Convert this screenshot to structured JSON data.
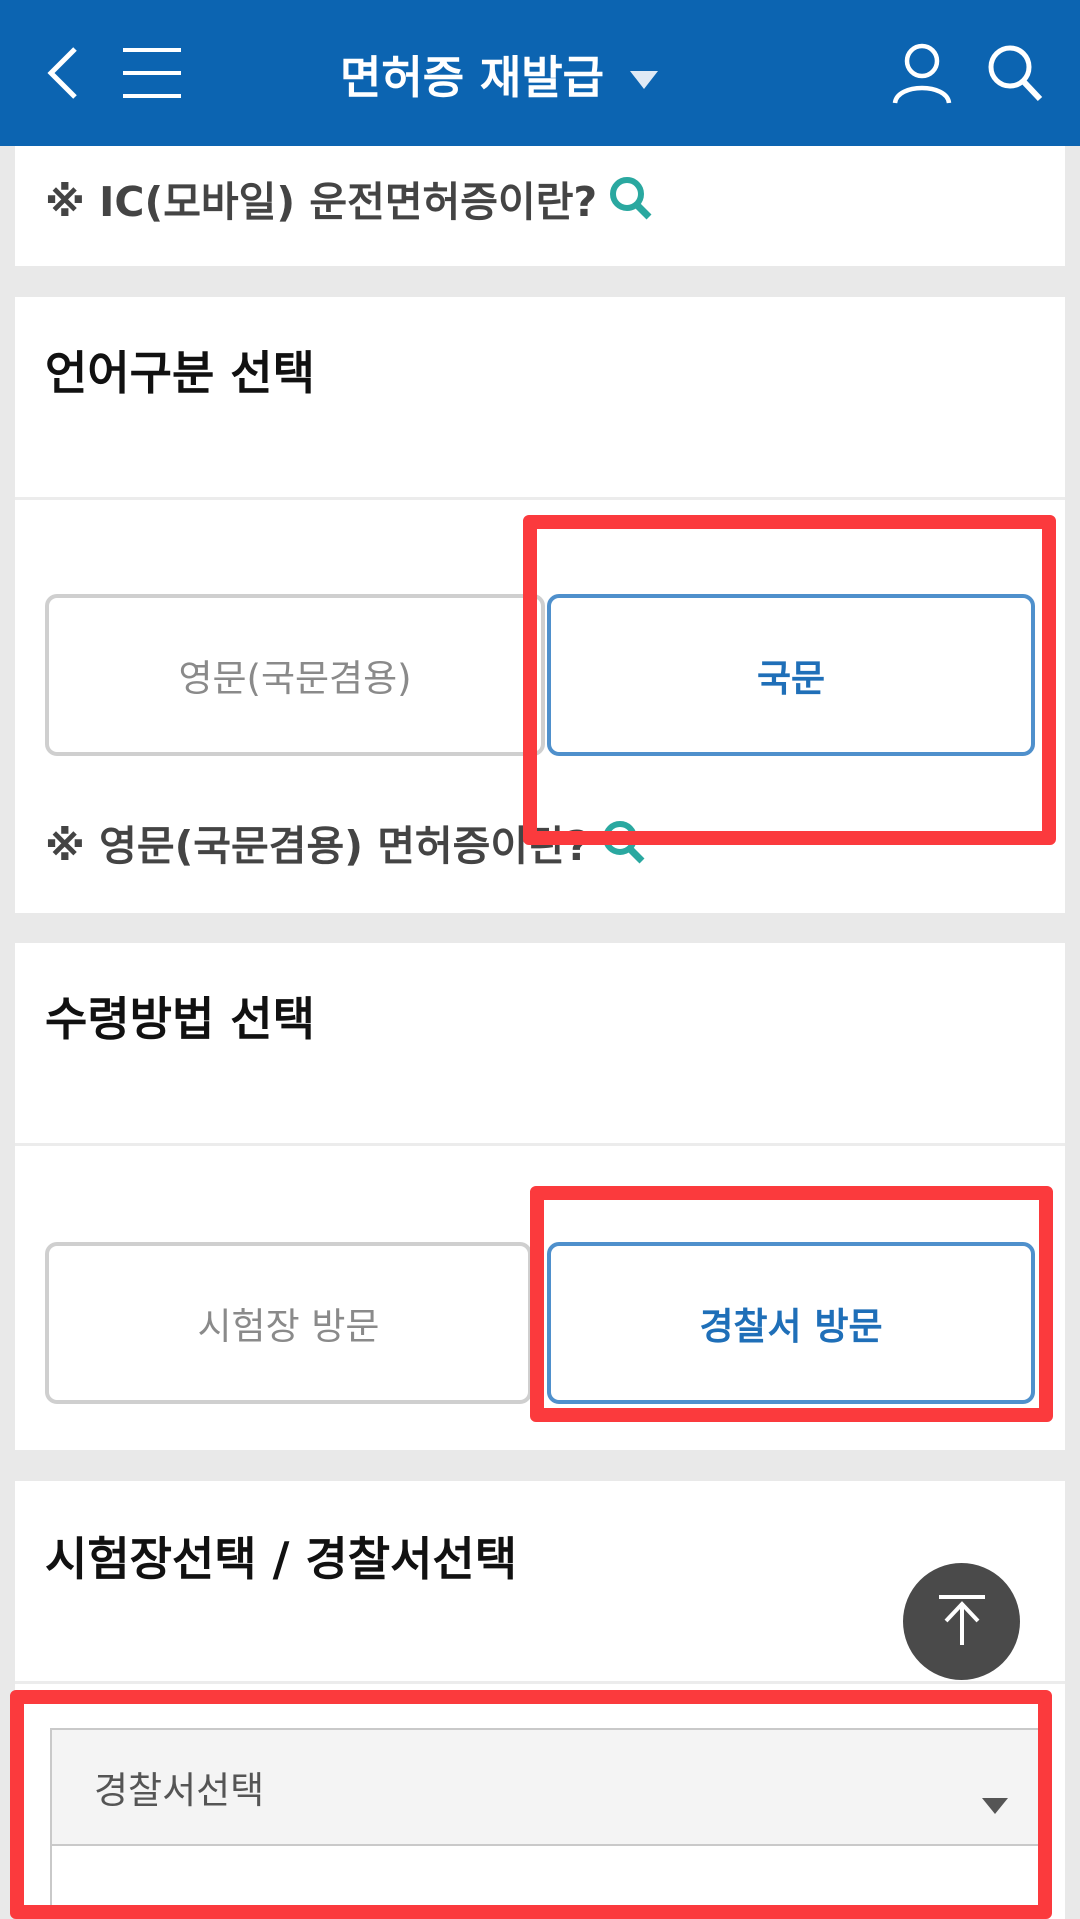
{
  "header": {
    "title": "면허증 재발급",
    "icons": [
      "back-arrow-icon",
      "menu-icon",
      "caret-down-icon",
      "user-icon",
      "search-icon"
    ],
    "background": "#0c64b1"
  },
  "ic_note": {
    "text": "※ IC(모바일) 운전면허증이란?",
    "icon": "magnifier-icon"
  },
  "language": {
    "title": "언어구분 선택",
    "options": [
      {
        "label": "영문(국문겸용)",
        "selected": false
      },
      {
        "label": "국문",
        "selected": true
      }
    ],
    "note": "※ 영문(국문겸용) 면허증이란?"
  },
  "receive": {
    "title": "수령방법 선택",
    "options": [
      {
        "label": "시험장 방문",
        "selected": false
      },
      {
        "label": "경찰서 방문",
        "selected": true
      }
    ]
  },
  "place": {
    "title": "시험장선택 / 경찰서선택",
    "select_value": "경찰서선택"
  },
  "colors": {
    "accent": "#1f6fb8",
    "highlight": "#fb3a3d",
    "scroll_top_button": "#4a4a4a"
  }
}
